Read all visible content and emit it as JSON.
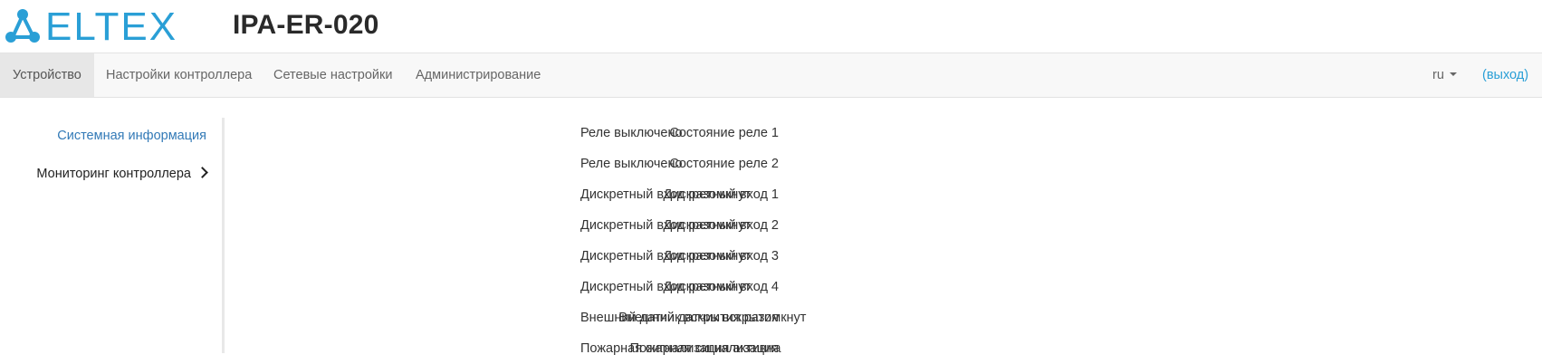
{
  "header": {
    "brand": "ELTEX",
    "device_title": "IPA-ER-020",
    "brand_color": "#2a9fd6"
  },
  "nav": {
    "items": [
      {
        "label": "Устройство",
        "active": true
      },
      {
        "label": "Настройки контроллера",
        "active": false
      },
      {
        "label": "Сетевые настройки",
        "active": false
      },
      {
        "label": "Администрирование",
        "active": false
      }
    ],
    "language": "ru",
    "logout": "(выход)"
  },
  "sidebar": {
    "items": [
      {
        "label": "Системная информация"
      },
      {
        "label": "Мониторинг контроллера"
      }
    ]
  },
  "status": {
    "rows": [
      {
        "label": "Состояние реле 1",
        "value": "Реле выключено"
      },
      {
        "label": "Состояние реле 2",
        "value": "Реле выключено"
      },
      {
        "label": "Дискретный вход 1",
        "value": "Дискретный вход разомкнут"
      },
      {
        "label": "Дискретный вход 2",
        "value": "Дискретный вход разомкнут"
      },
      {
        "label": "Дискретный вход 3",
        "value": "Дискретный вход разомкнут"
      },
      {
        "label": "Дискретный вход 4",
        "value": "Дискретный вход разомкнут"
      },
      {
        "label": "Внешний датчик вскрытия",
        "value": "Внешний датчик вскрытия разомкнут"
      },
      {
        "label": "Пожарная сигнализация",
        "value": "Пожарная сигнализация активна"
      }
    ]
  }
}
